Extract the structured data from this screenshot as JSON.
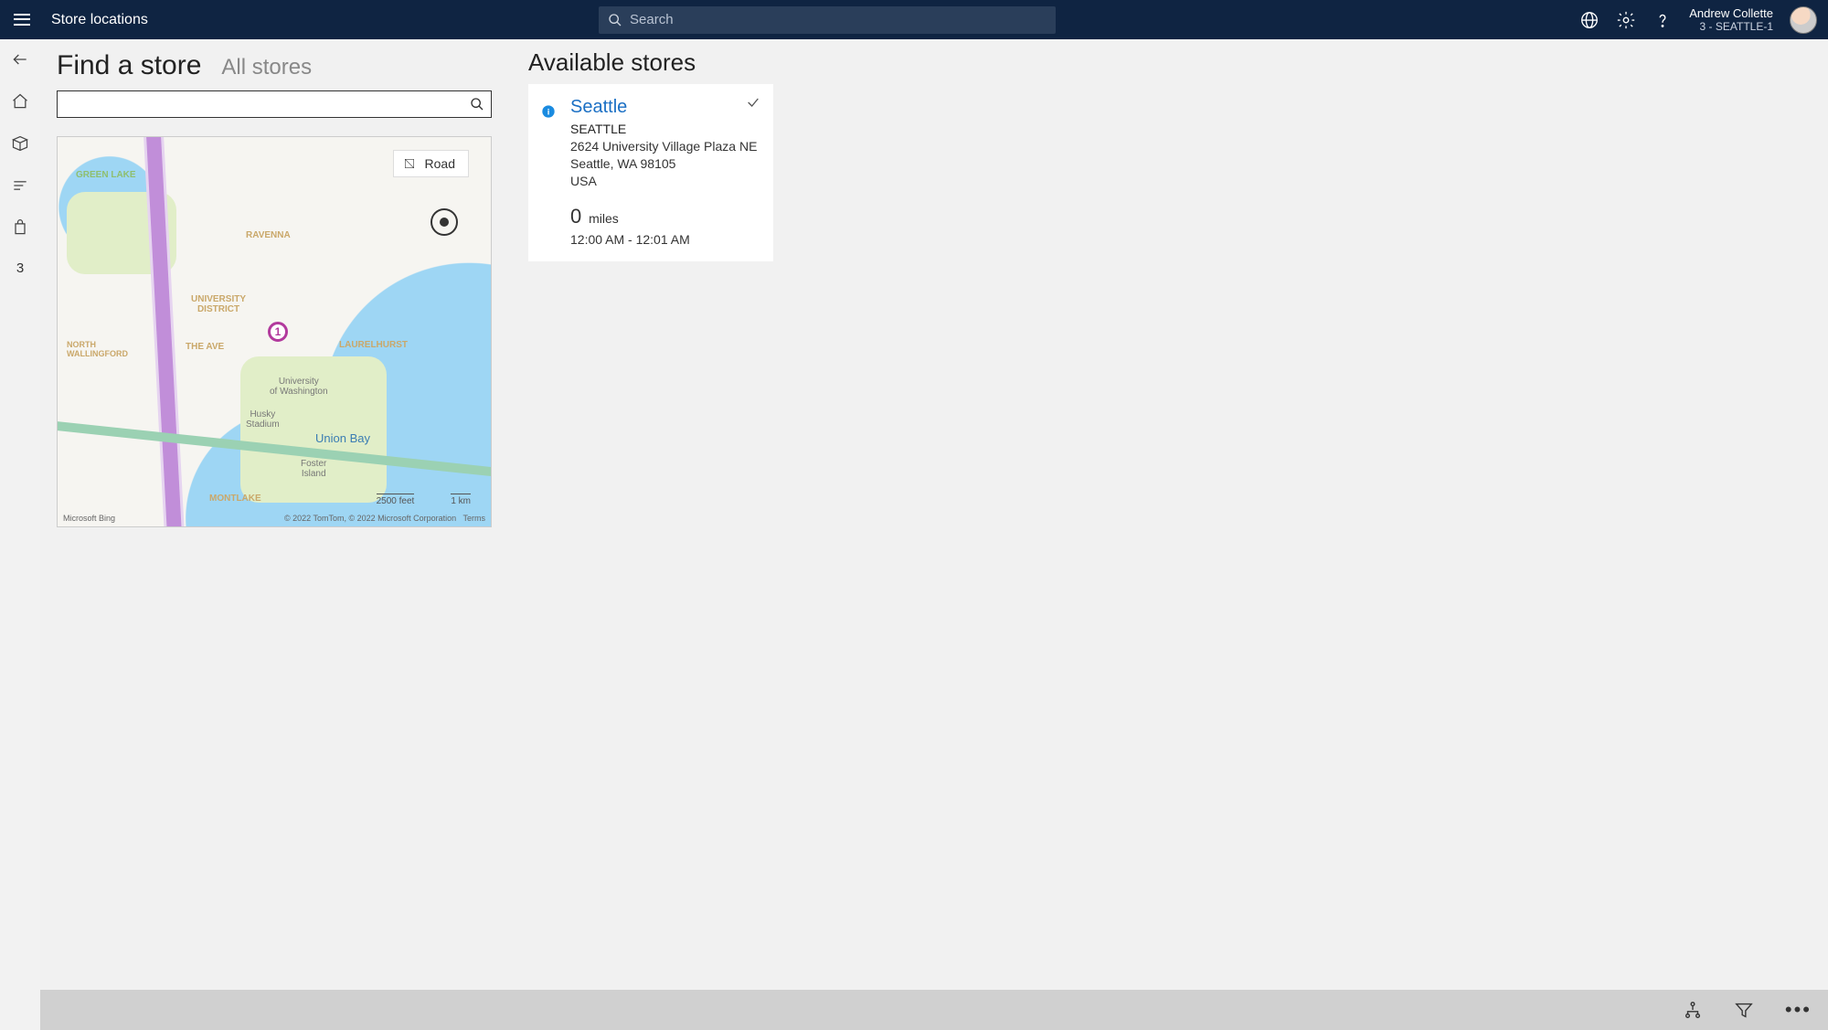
{
  "topbar": {
    "app_title": "Store locations",
    "search_placeholder": "Search",
    "user_name": "Andrew Collette",
    "user_sub": "3 - SEATTLE-1"
  },
  "leftrail": {
    "count_badge": "3"
  },
  "page": {
    "title": "Find a store",
    "subtitle": "All stores"
  },
  "map": {
    "layer_label": "Road",
    "pin_number": "1",
    "labels": {
      "union_bay": "Union Bay",
      "university_district": "UNIVERSITY\nDISTRICT",
      "ravenna": "RAVENNA",
      "laurelhurst": "LAURELHURST",
      "green_lake": "GREEN LAKE",
      "montlake": "MONTLAKE",
      "the_ave": "THE AVE",
      "wallingford": "NORTH\nWALLINGFORD",
      "uow": "University\nof Washington",
      "husky": "Husky\nStadium",
      "foster": "Foster\nIsland"
    },
    "scale_left": "2500 feet",
    "scale_right": "1 km",
    "attrib_logo": "Microsoft Bing",
    "attrib_text": "© 2022 TomTom, © 2022 Microsoft Corporation",
    "attrib_terms": "Terms"
  },
  "available": {
    "heading": "Available stores",
    "stores": [
      {
        "name": "Seattle",
        "city": "SEATTLE",
        "addr1": "2624 University Village Plaza NE",
        "addr2": "Seattle, WA 98105",
        "country": "USA",
        "distance_value": "0",
        "distance_unit": "miles",
        "hours": "12:00 AM - 12:01 AM"
      }
    ]
  }
}
